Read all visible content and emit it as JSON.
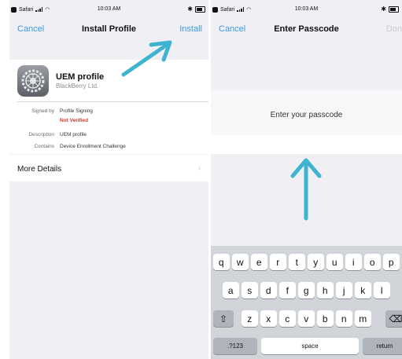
{
  "left_screen": {
    "status": {
      "carrier": "Safari",
      "time": "10:03 AM"
    },
    "nav": {
      "cancel": "Cancel",
      "title": "Install Profile",
      "install": "Install"
    },
    "profile": {
      "name": "UEM profile",
      "org": "BlackBerry Ltd.",
      "details": [
        {
          "label": "Signed by",
          "value": "Profile Signing"
        },
        {
          "label": "",
          "value": "Not Verified"
        },
        {
          "label": "Description",
          "value": "UEM profile"
        },
        {
          "label": "Contains",
          "value": "Device Enrollment Challenge"
        }
      ]
    },
    "more_details": "More Details",
    "chevron": "›"
  },
  "right_screen": {
    "status": {
      "carrier": "Safari",
      "time": "10:03 AM"
    },
    "nav": {
      "cancel": "Cancel",
      "title": "Enter Passcode",
      "done": "Done"
    },
    "prompt": "Enter your passcode",
    "keyboard": {
      "row1": [
        "q",
        "w",
        "e",
        "r",
        "t",
        "y",
        "u",
        "i",
        "o",
        "p"
      ],
      "row2": [
        "a",
        "s",
        "d",
        "f",
        "g",
        "h",
        "j",
        "k",
        "l"
      ],
      "row3": [
        "z",
        "x",
        "c",
        "v",
        "b",
        "n",
        "m"
      ],
      "shift": "⇧",
      "backspace": "⌫",
      "numbers": ".?123",
      "space": "space",
      "return": "return"
    }
  },
  "colors": {
    "accent": "#3b9ae1",
    "warning": "#e0342b",
    "annotation_arrow": "#3fb3cf"
  }
}
